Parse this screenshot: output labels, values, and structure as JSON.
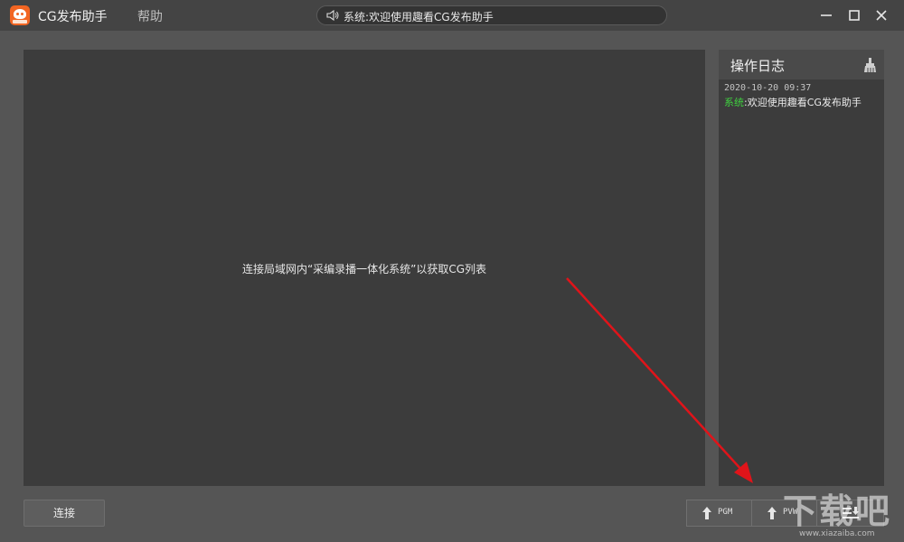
{
  "titlebar": {
    "app_title": "CG发布助手",
    "menu_help": "帮助",
    "notice": "系统:欢迎使用趣看CG发布助手",
    "logo_icon": "cg-app-logo",
    "notice_icon": "speaker-icon",
    "window_controls": [
      "minimize-icon",
      "maximize-icon",
      "close-icon"
    ]
  },
  "preview": {
    "message": "连接局域网内“采编录播一体化系统”以获取CG列表"
  },
  "log": {
    "title": "操作日志",
    "clear_icon": "broom-icon",
    "entries": [
      {
        "time": "2020-10-20 09:37",
        "source": "系统",
        "message": ":欢迎使用趣看CG发布助手"
      }
    ]
  },
  "bottom": {
    "connect_label": "连接",
    "pgm_label": "PGM",
    "pvw_label": "PVW",
    "list_icon": "list-download-icon"
  },
  "watermark": {
    "text": "下载吧",
    "url": "www.xiazaiba.com"
  },
  "colors": {
    "background": "#555555",
    "titlebar": "#444444",
    "panel": "#3c3c3c",
    "log_source": "#3fd13f",
    "logo": "#f26522",
    "annotation_arrow": "#e0141a"
  }
}
